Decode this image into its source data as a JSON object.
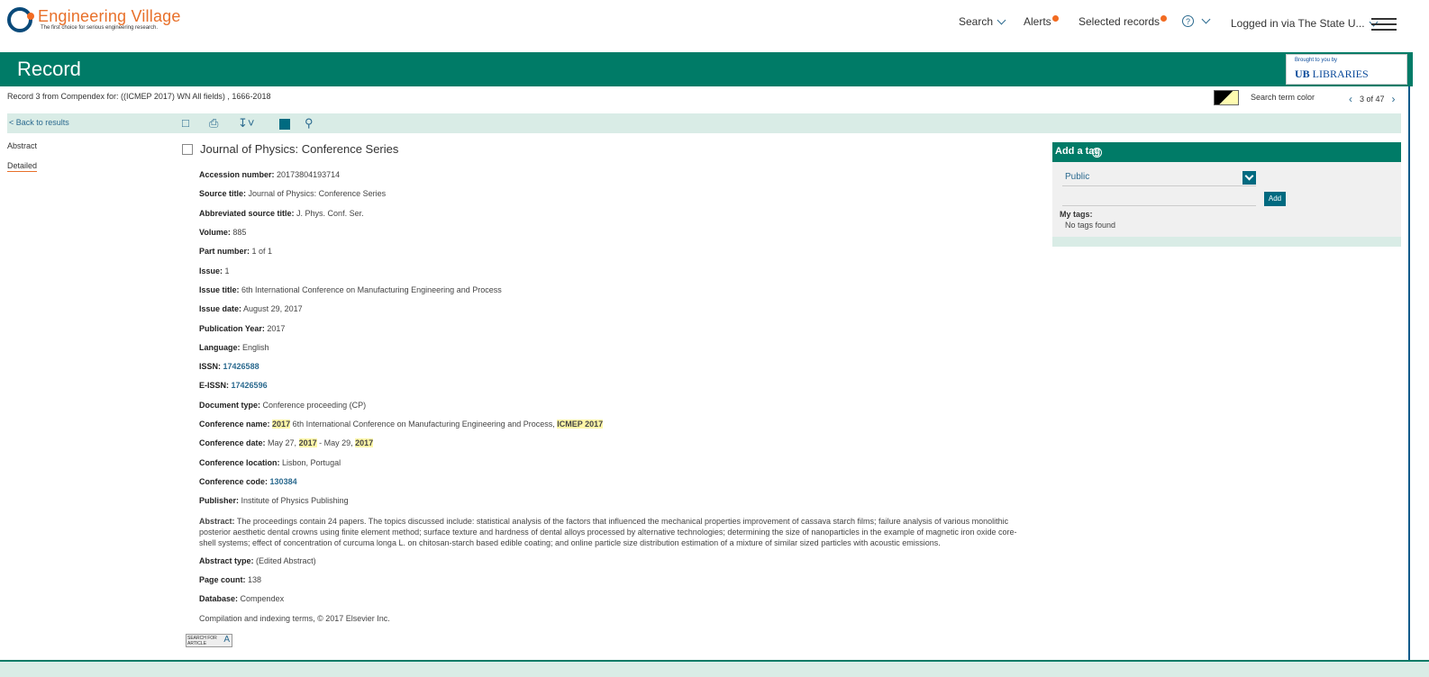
{
  "header": {
    "logo_title": "Engineering Village",
    "logo_tm": "TM",
    "logo_tagline": "The first choice for serious engineering research.",
    "nav": {
      "search": "Search",
      "alerts": "Alerts",
      "selected": "Selected records",
      "logged_in": "Logged in via The State U..."
    }
  },
  "banner": {
    "title": "Record",
    "brought_by": "Brought to you by",
    "library": "LIBRARIES"
  },
  "breadcrumb": "Record 3 from Compendex for: ((ICMEP 2017) WN All fields) , 1666-2018",
  "search_term_color_label": "Search term color",
  "pager": "3 of 47",
  "toolbar": {
    "back": "< Back to results"
  },
  "sidebar": {
    "abstract": "Abstract",
    "detailed": "Detailed"
  },
  "record": {
    "title": "Journal of Physics: Conference Series",
    "fields": {
      "accession_label": "Accession number:",
      "accession": "20173804193714",
      "source_label": "Source title:",
      "source": "Journal of Physics: Conference Series",
      "abbrev_label": "Abbreviated source title:",
      "abbrev": "J. Phys. Conf. Ser.",
      "volume_label": "Volume:",
      "volume": "885",
      "part_label": "Part number:",
      "part": "1 of 1",
      "issue_label": "Issue:",
      "issue": "1",
      "issue_title_label": "Issue title:",
      "issue_title": "6th International Conference on Manufacturing Engineering and Process",
      "issue_date_label": "Issue date:",
      "issue_date": "August 29, 2017",
      "pub_year_label": "Publication Year:",
      "pub_year": "2017",
      "language_label": "Language:",
      "language": "English",
      "issn_label": "ISSN:",
      "issn": "17426588",
      "eissn_label": "E-ISSN:",
      "eissn": "17426596",
      "doctype_label": "Document type:",
      "doctype": "Conference proceeding (CP)",
      "confname_label": "Conference name:",
      "confname_hl1": "2017",
      "confname_mid": " 6th International Conference on Manufacturing Engineering and Process, ",
      "confname_hl2": "ICMEP 2017",
      "confdate_label": "Conference date:",
      "confdate_a": "May 27, ",
      "confdate_hl1": "2017",
      "confdate_b": " - May 29, ",
      "confdate_hl2": "2017",
      "location_label": "Conference location:",
      "location": "Lisbon, Portugal",
      "code_label": "Conference code:",
      "code": "130384",
      "publisher_label": "Publisher:",
      "publisher": "Institute of Physics Publishing",
      "abstract_label": "Abstract:",
      "abstract": "The proceedings contain 24 papers. The topics discussed include: statistical analysis of the factors that influenced the mechanical properties improvement of cassava starch films; failure analysis of various monolithic posterior aesthetic dental crowns using finite element method; surface texture and hardness of dental alloys processed by alternative technologies; determining the size of nanoparticles in the example of magnetic iron oxide core-shell systems; effect of concentration of curcuma longa L. on chitosan-starch based edible coating; and online particle size distribution estimation of a mixture of similar sized particles with acoustic emissions.",
      "abstract_type_label": "Abstract type:",
      "abstract_type": "(Edited Abstract)",
      "pagecount_label": "Page count:",
      "pagecount": "138",
      "database_label": "Database:",
      "database": "Compendex",
      "copyright": "Compilation and indexing terms, © 2017 Elsevier Inc."
    },
    "findit": "SEARCH FOR ARTICLE"
  },
  "tags": {
    "header": "Add a tag",
    "visibility": "Public",
    "add": "Add",
    "my_tags": "My tags:",
    "none": "No tags found"
  }
}
